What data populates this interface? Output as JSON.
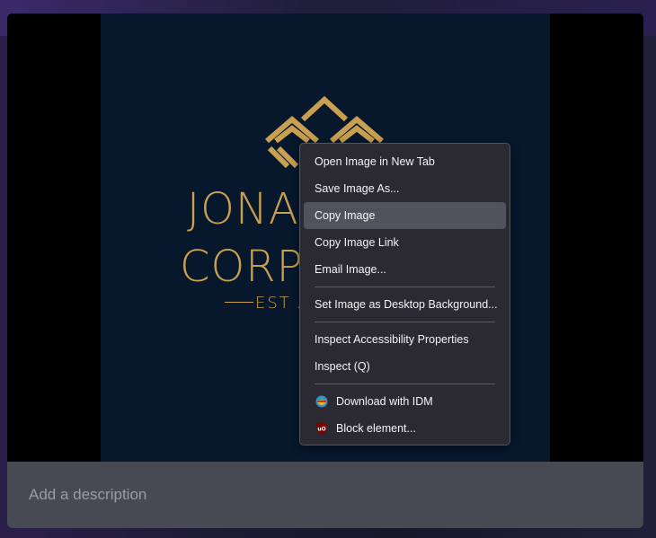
{
  "viewer": {
    "brand_line1": "JONAS",
    "brand_line2": "CORPO",
    "brand_est": "EST A",
    "description_placeholder": "Add a description"
  },
  "context_menu": {
    "items": [
      {
        "label": "Open Image in New Tab"
      },
      {
        "label": "Save Image As..."
      },
      {
        "label": "Copy Image"
      },
      {
        "label": "Copy Image Link"
      },
      {
        "label": "Email Image..."
      },
      {
        "label": "Set Image as Desktop Background..."
      },
      {
        "label": "Inspect Accessibility Properties"
      },
      {
        "label": "Inspect (Q)"
      },
      {
        "label": "Download with IDM",
        "icon": "idm-icon"
      },
      {
        "label": "Block element...",
        "icon": "ublock-icon"
      }
    ],
    "highlighted": "Copy Image"
  },
  "colors": {
    "brand_gold": "#c9a04f",
    "photo_bg": "#07182d",
    "menu_bg": "#2b2a33",
    "menu_hover": "#52525e"
  }
}
